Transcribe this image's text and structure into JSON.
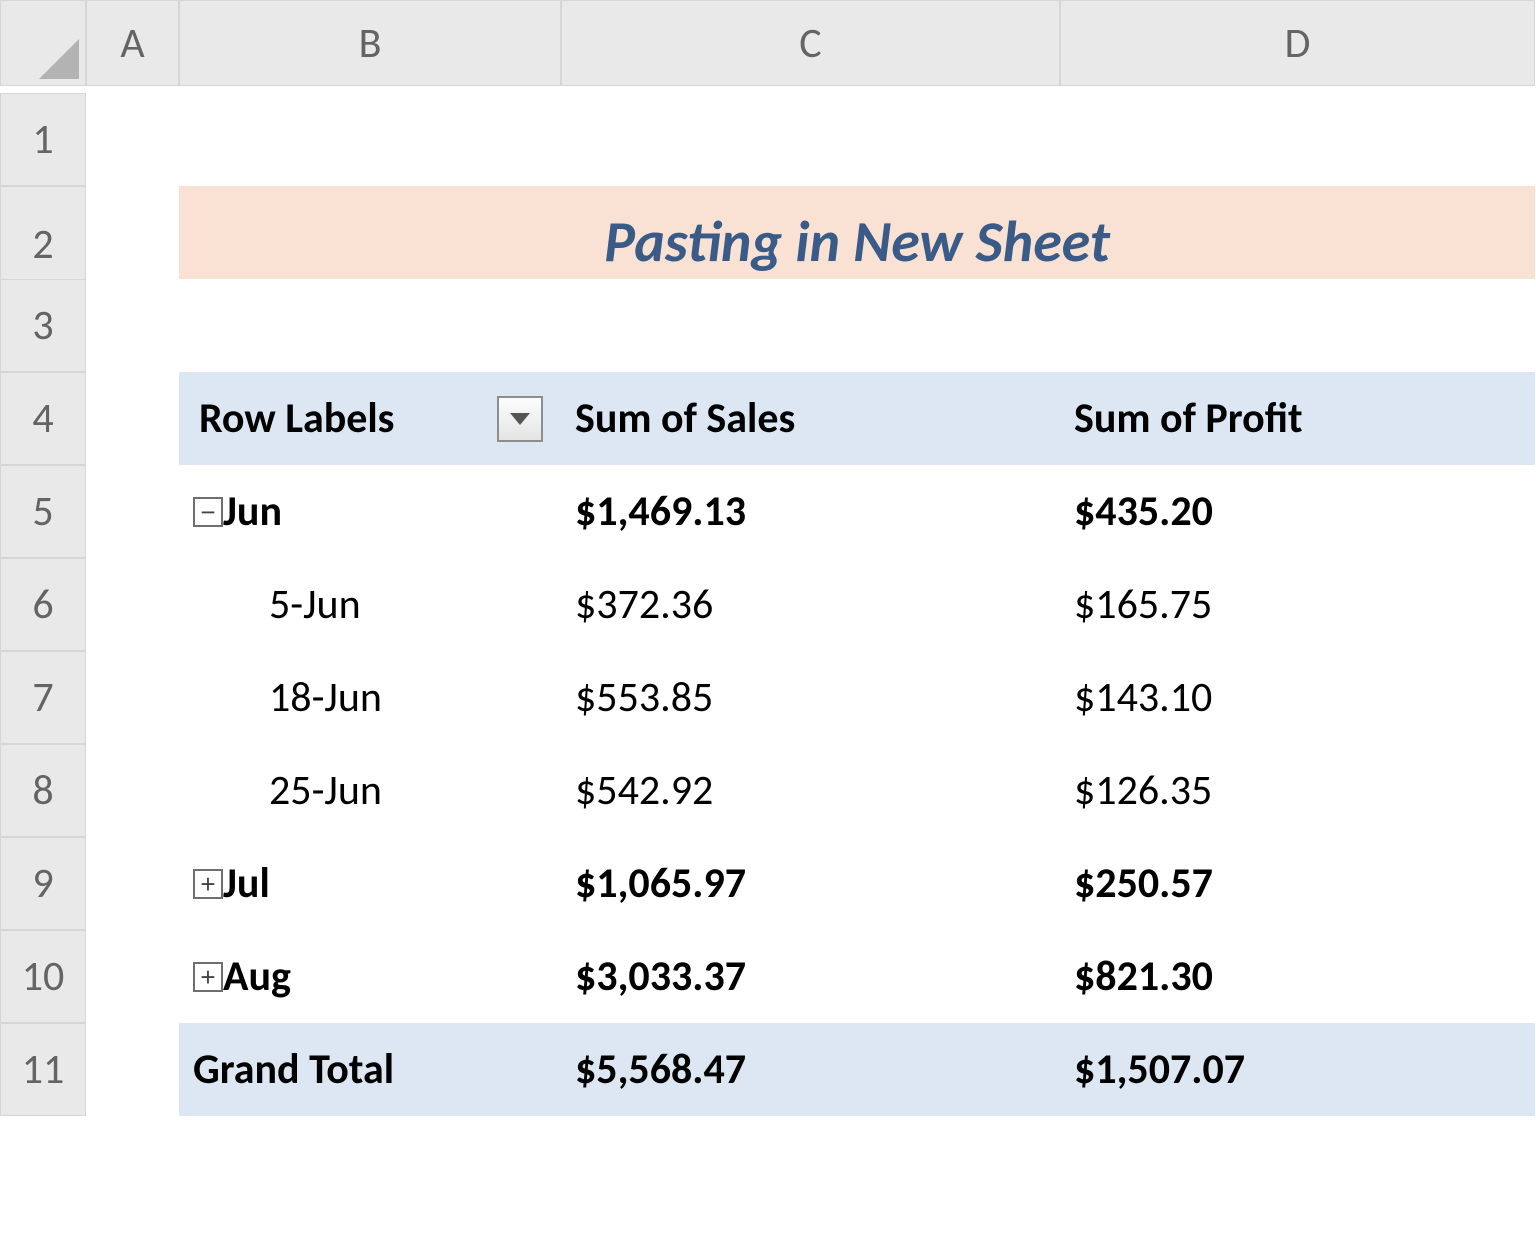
{
  "columns": {
    "A": "A",
    "B": "B",
    "C": "C",
    "D": "D"
  },
  "rows": [
    "1",
    "2",
    "3",
    "4",
    "5",
    "6",
    "7",
    "8",
    "9",
    "10",
    "11"
  ],
  "title": "Pasting in New Sheet",
  "pivot": {
    "header": {
      "row_labels": "Row Labels",
      "col1": "Sum of Sales",
      "col2": "Sum of Profit"
    },
    "rows": [
      {
        "type": "group",
        "icon": "minus",
        "label": "Jun",
        "v1": "$1,469.13",
        "v2": "$435.20"
      },
      {
        "type": "item",
        "label": "5-Jun",
        "v1": "$372.36",
        "v2": "$165.75"
      },
      {
        "type": "item",
        "label": "18-Jun",
        "v1": "$553.85",
        "v2": "$143.10"
      },
      {
        "type": "item",
        "label": "25-Jun",
        "v1": "$542.92",
        "v2": "$126.35"
      },
      {
        "type": "group",
        "icon": "plus",
        "label": "Jul",
        "v1": "$1,065.97",
        "v2": "$250.57"
      },
      {
        "type": "group",
        "icon": "plus",
        "label": "Aug",
        "v1": "$3,033.37",
        "v2": "$821.30"
      },
      {
        "type": "total",
        "label": "Grand Total",
        "v1": "$5,568.47",
        "v2": "$1,507.07"
      }
    ]
  },
  "icons": {
    "minus": "−",
    "plus": "+"
  }
}
